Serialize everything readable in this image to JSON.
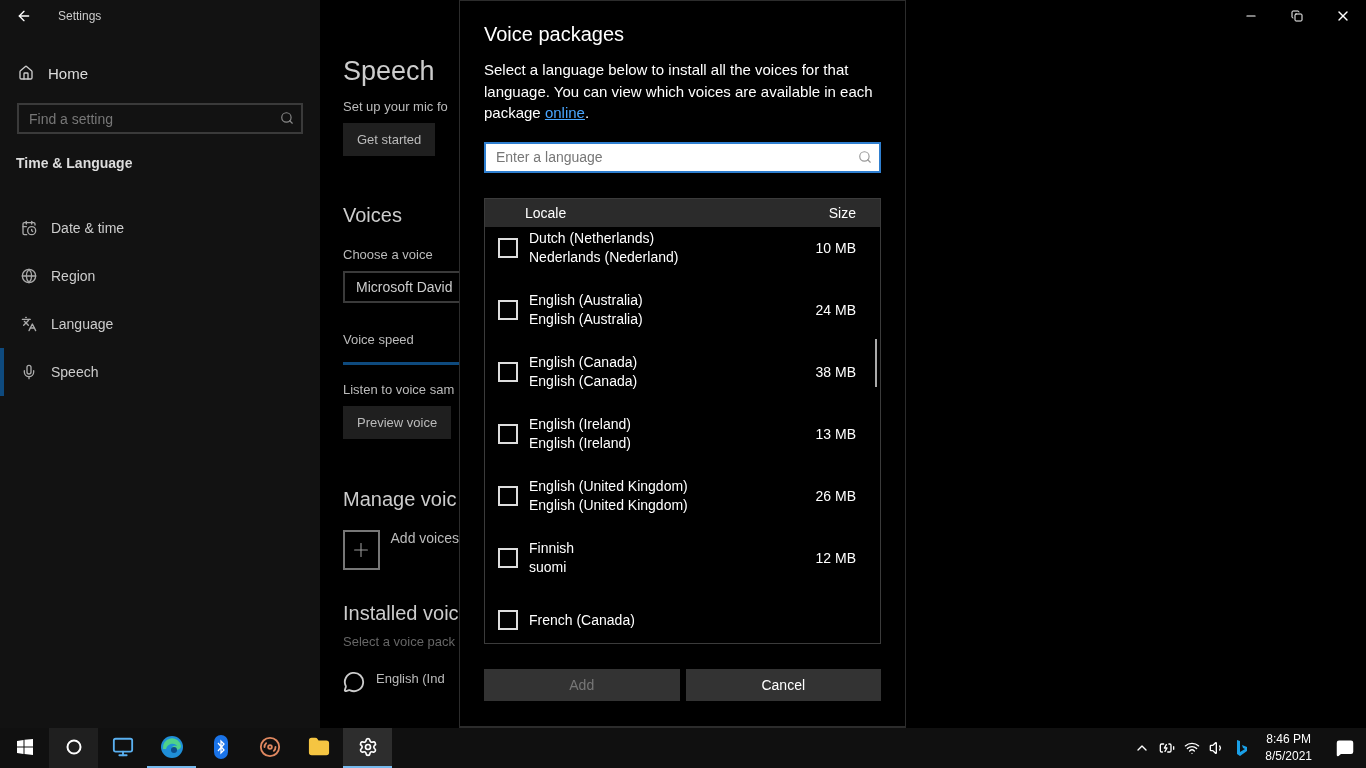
{
  "window": {
    "title": "Settings"
  },
  "nav": {
    "home": "Home",
    "search": {
      "placeholder": "Find a setting"
    },
    "section": "Time & Language",
    "items": [
      {
        "label": "Date & time",
        "kind": "calendar",
        "selected": false
      },
      {
        "label": "Region",
        "kind": "globe",
        "selected": false
      },
      {
        "label": "Language",
        "kind": "language",
        "selected": false
      },
      {
        "label": "Speech",
        "kind": "mic",
        "selected": true
      }
    ]
  },
  "main": {
    "title": "Speech",
    "intro": "Set up your mic fo",
    "get_started": "Get started",
    "voices_heading": "Voices",
    "choose_label": "Choose a voice",
    "voice": "Microsoft David",
    "speed_label": "Voice speed",
    "listen_label": "Listen to voice sam",
    "preview": "Preview voice",
    "manage_heading": "Manage voic",
    "add_voices": "Add voices",
    "installed_heading": "Installed voic",
    "installed_hint": "Select a voice pack",
    "installed_voice": "English (Ind"
  },
  "dialog": {
    "title": "Voice packages",
    "description": "Select a language below to install all the voices for that language. You can view which voices are available in each package",
    "link": "online",
    "description_end": ".",
    "search": {
      "placeholder": "Enter a language"
    },
    "columns": [
      "Locale",
      "Size"
    ],
    "rows": [
      {
        "name": "Dutch (Netherlands)",
        "native": "Nederlands (Nederland)",
        "size": "10 MB",
        "checked": false
      },
      {
        "name": "English (Australia)",
        "native": "English (Australia)",
        "size": "24 MB",
        "checked": false
      },
      {
        "name": "English (Canada)",
        "native": "English (Canada)",
        "size": "38 MB",
        "checked": false
      },
      {
        "name": "English (Ireland)",
        "native": "English (Ireland)",
        "size": "13 MB",
        "checked": false
      },
      {
        "name": "English (United Kingdom)",
        "native": "English (United Kingdom)",
        "size": "26 MB",
        "checked": false
      },
      {
        "name": "Finnish",
        "native": "suomi",
        "size": "12 MB",
        "checked": false
      },
      {
        "name": "French (Canada)",
        "checked": false
      }
    ],
    "buttons": [
      {
        "label": "Add",
        "disabled": true
      },
      {
        "label": "Cancel",
        "disabled": false
      }
    ]
  },
  "taskbar": {
    "apps": [
      {
        "kind": "computer",
        "running": false,
        "selected": false
      },
      {
        "kind": "edge",
        "running": true,
        "selected": false
      },
      {
        "kind": "bluetooth",
        "running": false,
        "selected": false
      },
      {
        "kind": "disc",
        "running": false,
        "selected": false
      },
      {
        "kind": "folder",
        "running": false,
        "selected": false
      },
      {
        "kind": "settings",
        "running": true,
        "selected": true
      }
    ],
    "tray": [
      {
        "kind": "chevron"
      },
      {
        "kind": "battery"
      },
      {
        "kind": "wifi"
      },
      {
        "kind": "volume"
      },
      {
        "kind": "bing"
      }
    ],
    "time": "8:46 PM",
    "date": "8/5/2021"
  }
}
